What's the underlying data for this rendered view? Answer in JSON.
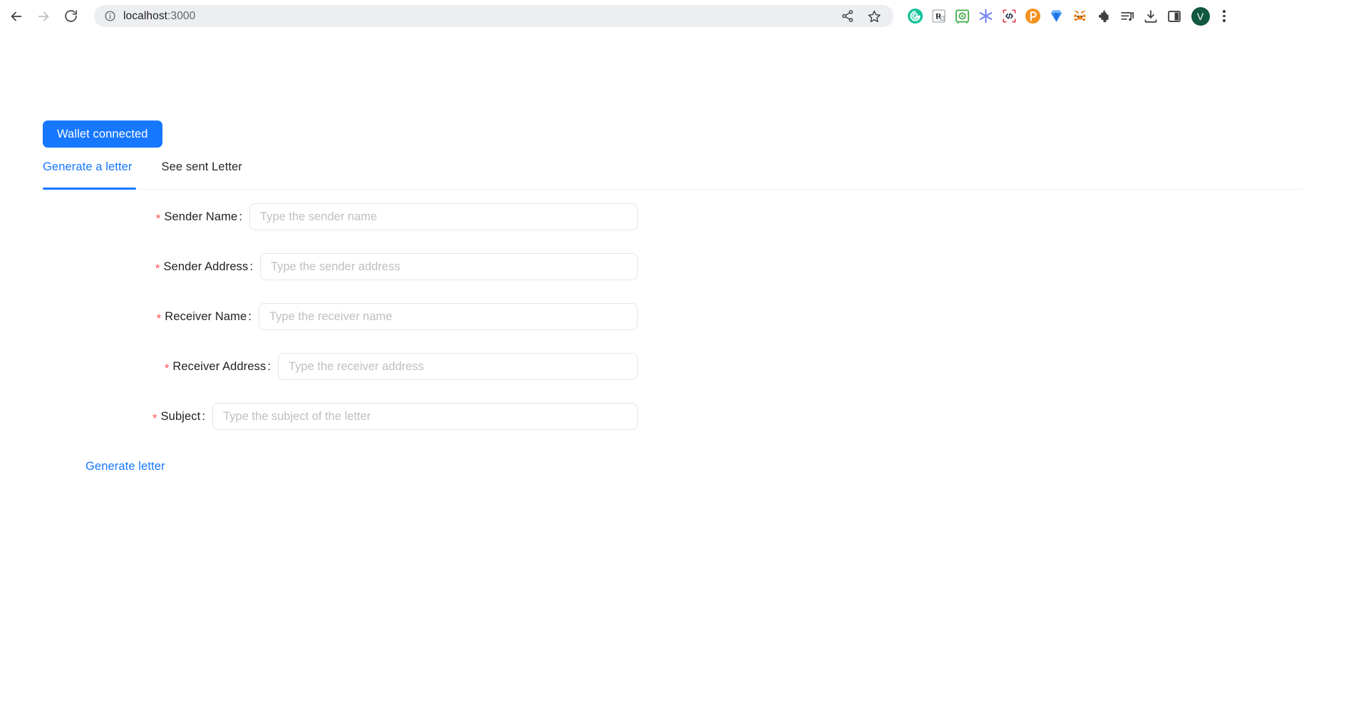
{
  "browser": {
    "back_label": "Back",
    "forward_label": "Forward",
    "reload_label": "Reload",
    "url_host": "localhost",
    "url_port": ":3000",
    "site_info_label": "View site information",
    "share_label": "Share this page",
    "bookmark_label": "Bookmark this tab",
    "profile_initial": "V",
    "menu_label": "Customize and control Chrome",
    "extensions": [
      {
        "name": "grammarly-icon",
        "title": "Grammarly",
        "color": "#15c39a"
      },
      {
        "name": "readwise-icon",
        "title": "Readwise",
        "color": "#3c4043"
      },
      {
        "name": "vault-icon",
        "title": "Password Vault",
        "color": "#4caf50"
      },
      {
        "name": "snowflake-icon",
        "title": "Snowflake",
        "color": "#5b6ef5"
      },
      {
        "name": "code-brackets-icon",
        "title": "Code Inspector",
        "color": "#e0364f"
      },
      {
        "name": "pocket-icon",
        "title": "Pocket",
        "color": "#f59120"
      },
      {
        "name": "gem-icon",
        "title": "Gem Wallet",
        "color": "#2f86f6"
      },
      {
        "name": "metamask-fox-icon",
        "title": "MetaMask",
        "color": "#e2761b"
      },
      {
        "name": "puzzle-icon",
        "title": "Extensions",
        "color": "#3c4043"
      },
      {
        "name": "playlist-icon",
        "title": "Media playlist",
        "color": "#3c4043"
      },
      {
        "name": "download-icon",
        "title": "Downloads",
        "color": "#3c4043"
      },
      {
        "name": "side-panel-icon",
        "title": "Side panel",
        "color": "#3c4043"
      }
    ]
  },
  "app": {
    "wallet_button": "Wallet connected",
    "accent_color": "#1677ff",
    "required_color": "#ff4d4f",
    "tabs": [
      {
        "label": "Generate a letter",
        "active": true
      },
      {
        "label": "See sent Letter",
        "active": false
      }
    ],
    "form": {
      "fields": [
        {
          "label": "Sender Name",
          "placeholder": "Type the sender name",
          "value": "",
          "required": true,
          "input_width": 545
        },
        {
          "label": "Sender Address",
          "placeholder": "Type the sender address",
          "value": "",
          "required": true,
          "input_width": 530
        },
        {
          "label": "Receiver Name",
          "placeholder": "Type the receiver name",
          "value": "",
          "required": true,
          "input_width": 532
        },
        {
          "label": "Receiver Address",
          "placeholder": "Type the receiver address",
          "value": "",
          "required": true,
          "input_width": 505
        },
        {
          "label": "Subject",
          "placeholder": "Type the subject of the letter",
          "value": "",
          "required": true,
          "input_width": 597
        }
      ],
      "submit_label": "Generate letter"
    }
  }
}
